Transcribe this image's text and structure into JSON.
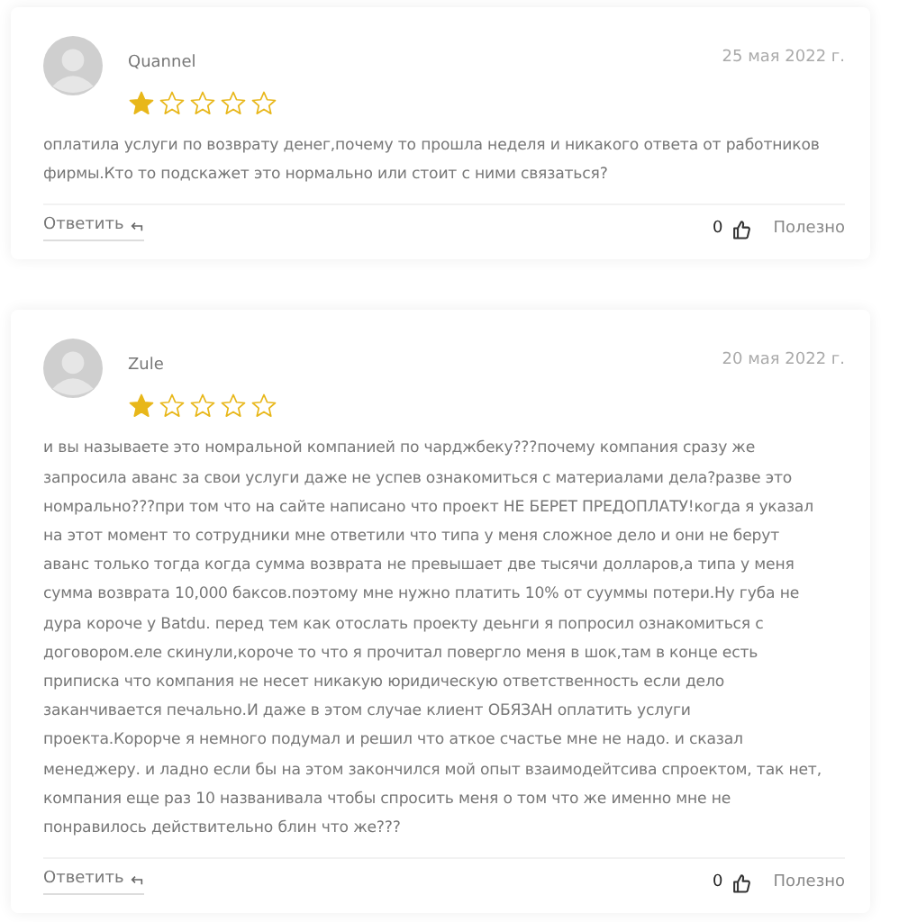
{
  "reviews": [
    {
      "author": "Quannel",
      "date": "25 мая 2022 г.",
      "stars": 1,
      "text": "оплатила услуги по возврату денег,почему то прошла неделя и никакого ответа от работников фирмы.Кто то подскажет это нормально или стоит с ними связаться?",
      "reply": "Ответить",
      "likes": "0",
      "helpful": "Полезно"
    },
    {
      "author": "Zule",
      "date": "20 мая 2022 г.",
      "stars": 1,
      "text": "и вы называете это номральной компанией по чарджбеку???почему компания сразу же запросила аванс за свои услуги даже не успев ознакомиться с материалами дела?разве это номрально???при том что на сайте написано что проект НЕ БЕРЕТ ПРЕДОПЛАТУ!когда я указал на этот момент то сотрудники мне ответили что типа у меня сложное дело и они не берут аванс только тогда когда сумма возврата не превышает две тысячи долларов,а типа у меня сумма возврата 10,000 баксов.поэтому мне нужно платить 10% от сууммы потери.Ну губа не дура короче у Batdu. перед тем как отослать проекту деьнги я попросил ознакомиться с договором.еле скинули,короче то что я прочитал повергло меня в шок,там в конце есть приписка что компания не несет никакую юридическую ответственность если дело заканчивается печально.И даже в этом случае клиент ОБЯЗАН оплатить услуги проекта.Корорче я немного подумал и решил что аткое счастье мне не надо. и сказал менеджеру. и ладно если бы на этом закончился мой опыт взаимодейтсива спроектом, так нет, компания еще раз 10 названивала чтобы спросить меня о том что же именно мне не понравилось действительно блин что же???",
      "reply": "Ответить",
      "likes": "0",
      "helpful": "Полезно"
    }
  ]
}
